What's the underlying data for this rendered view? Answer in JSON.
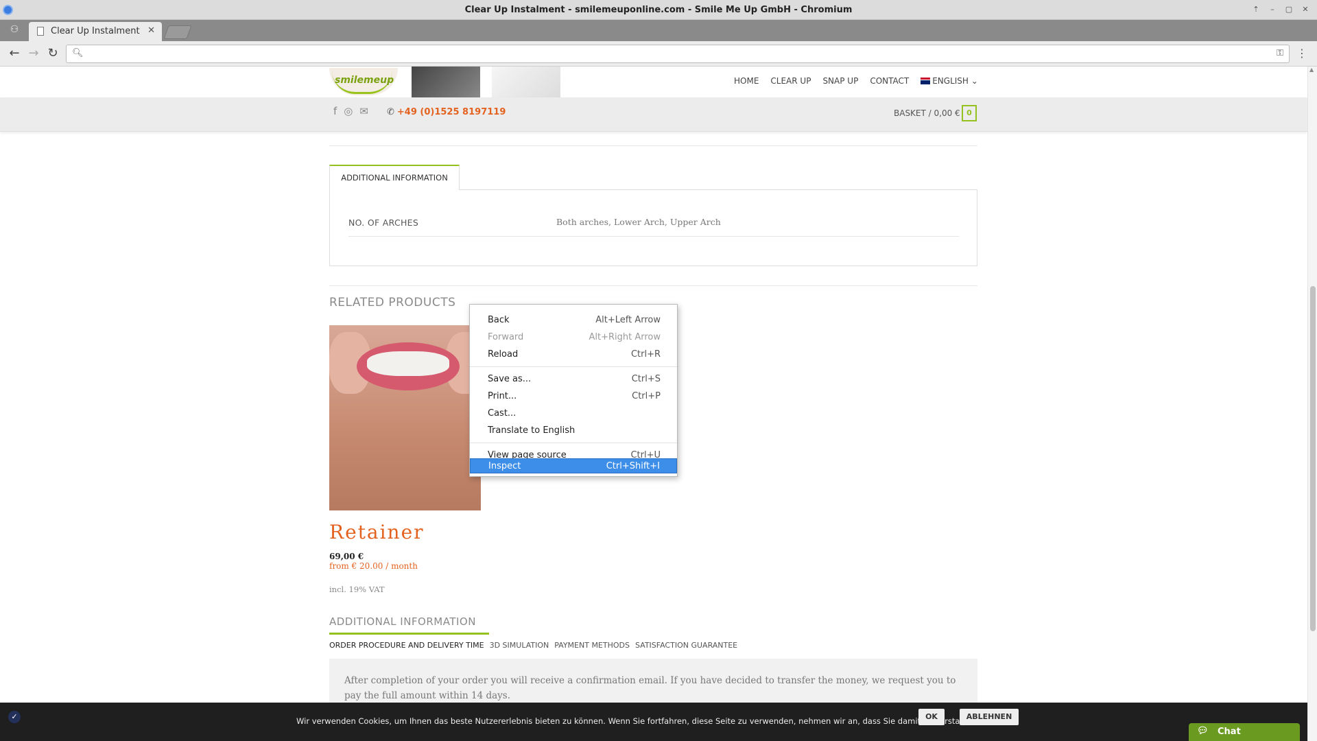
{
  "window": {
    "title": "Clear Up Instalment - smilemeuponline.com - Smile Me Up GmbH - Chromium"
  },
  "tab": {
    "label": "Clear Up Instalment"
  },
  "omnibox": {
    "value": ""
  },
  "site": {
    "logo_text": "smilemeup",
    "nav": {
      "home": "HOME",
      "clear_up": "CLEAR UP",
      "snap_up": "SNAP UP",
      "contact": "CONTACT",
      "language": "ENGLISH"
    },
    "phone": "+49 (0)1525 8197119",
    "basket": {
      "label": "BASKET / 0,00 €",
      "count": "0"
    }
  },
  "product_tabs": {
    "tab_label": "ADDITIONAL INFORMATION",
    "attribute_label": "NO. OF ARCHES",
    "attribute_value": "Both arches, Lower Arch, Upper Arch"
  },
  "related": {
    "heading": "RELATED PRODUCTS",
    "product": {
      "name": "Retainer",
      "price": "69,00 €",
      "finance": "from € 20.00 / month",
      "vat": "incl. 19% VAT"
    }
  },
  "additional_info": {
    "heading": "ADDITIONAL INFORMATION",
    "tabs": [
      "ORDER PROCEDURE AND DELIVERY TIME",
      "3D SIMULATION",
      "PAYMENT METHODS",
      "SATISFACTION GUARANTEE"
    ],
    "text": "After completion of your order you will receive a confirmation email. If you have decided to transfer the money, we request you to pay the full amount within 14 days."
  },
  "cookie": {
    "text": "Wir verwenden Cookies, um Ihnen das beste Nutzererlebnis bieten zu können. Wenn Sie fortfahren, diese Seite zu verwenden, nehmen wir an, dass Sie damit einverstanden sind.",
    "ok": "OK",
    "decline": "ABLEHNEN"
  },
  "chat": {
    "label": "Chat"
  },
  "context_menu": {
    "items": [
      {
        "label": "Back",
        "shortcut": "Alt+Left Arrow"
      },
      {
        "label": "Forward",
        "shortcut": "Alt+Right Arrow"
      },
      {
        "label": "Reload",
        "shortcut": "Ctrl+R"
      },
      {
        "label": "Save as...",
        "shortcut": "Ctrl+S"
      },
      {
        "label": "Print...",
        "shortcut": "Ctrl+P"
      },
      {
        "label": "Cast...",
        "shortcut": ""
      },
      {
        "label": "Translate to English",
        "shortcut": ""
      },
      {
        "label": "View page source",
        "shortcut": "Ctrl+U"
      },
      {
        "label": "Inspect",
        "shortcut": "Ctrl+Shift+I"
      }
    ]
  },
  "colors": {
    "brand_green": "#95c11f",
    "accent_orange": "#e46220",
    "menu_highlight": "#3d8ee8"
  }
}
